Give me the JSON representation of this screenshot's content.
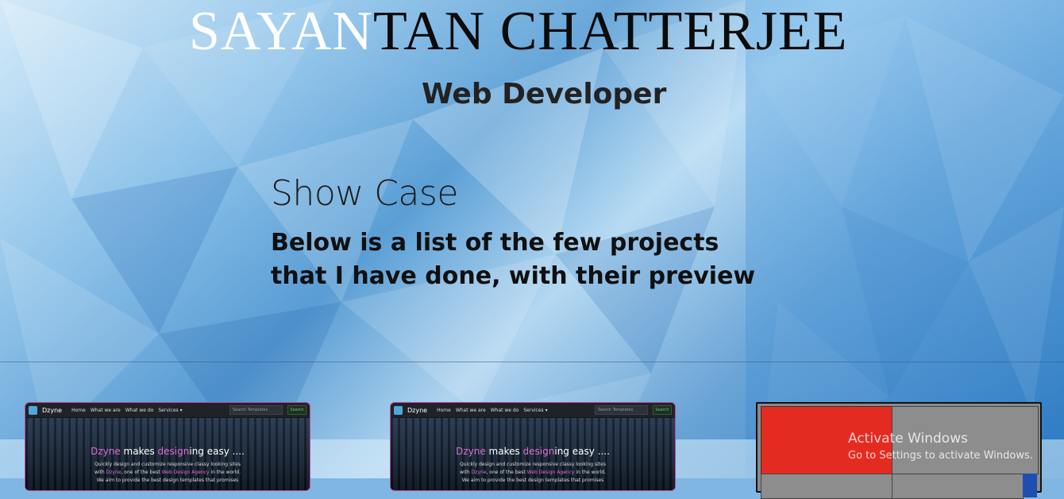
{
  "header": {
    "name_part1": "SAYAN",
    "name_part2": "TAN CHATTERJEE",
    "role": "Web Developer"
  },
  "showcase": {
    "title": "Show Case",
    "description": "Below is a list of the few projects that I have done, with their preview"
  },
  "projects": [
    {
      "brand": "Dzyne",
      "nav": [
        "Home",
        "What we are",
        "What we do",
        "Services ▾"
      ],
      "search_placeholder": "Search Templates",
      "search_button": "Search",
      "headline_pre": "Dzyne",
      "headline_mid": " makes ",
      "headline_accent": "design",
      "headline_post": "ing easy ....",
      "sub_line1": "Quickly design and customize responsive classy looking sites",
      "sub_line2_pre": "with ",
      "sub_line2_brand": "Dzyne",
      "sub_line2_mid": ", one of the best ",
      "sub_line2_accent": "Web Design Agency",
      "sub_line2_post": " in the world.",
      "sub_line3": "We aim to provide the best design templates that promises"
    },
    {
      "brand": "Dzyne",
      "nav": [
        "Home",
        "What we are",
        "What we do",
        "Services ▾"
      ],
      "search_placeholder": "Search Templates",
      "search_button": "Search",
      "headline_pre": "Dzyne",
      "headline_mid": " makes ",
      "headline_accent": "design",
      "headline_post": "ing easy ....",
      "sub_line1": "Quickly design and customize responsive classy looking sites",
      "sub_line2_pre": "with ",
      "sub_line2_brand": "Dzyne",
      "sub_line2_mid": ", one of the best ",
      "sub_line2_accent": "Web Design Agency",
      "sub_line2_post": " in the world.",
      "sub_line3": "We aim to provide the best design templates that promises"
    }
  ],
  "watermark": {
    "title": "Activate Windows",
    "subtitle": "Go to Settings to activate Windows."
  },
  "colors": {
    "accent_pink": "#e06bd0",
    "card_border": "#c147a8",
    "red_block": "#e42b22",
    "blue_block": "#1e4fb0"
  }
}
